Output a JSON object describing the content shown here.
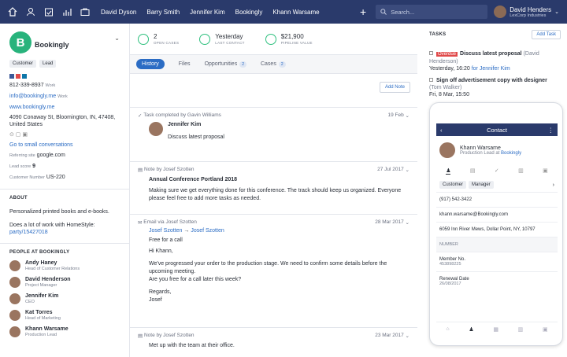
{
  "nav": {
    "links": [
      "David Dyson",
      "Barry Smith",
      "Jennifer Kim",
      "Bookingly",
      "Khann Warsame"
    ],
    "search_placeholder": "Search...",
    "user_name": "David Henders",
    "user_company": "LexCorp Industries"
  },
  "company": {
    "initial": "B",
    "name": "Bookingly",
    "tags": [
      "Customer",
      "Lead"
    ],
    "phone": "812-339-8937",
    "phone_type": "Work",
    "email": "info@bookingly.me",
    "email_type": "Work",
    "website": "www.bookingly.me",
    "address": "4090 Conaway St, Bloomington, IN, 47408, United States",
    "small_link": "Go to small conversations",
    "referring_label": "Referring site",
    "referring": "google.com",
    "lead_label": "Lead score",
    "lead": "9",
    "custnum_label": "Customer Number",
    "custnum": "US-220"
  },
  "about": {
    "title": "ABOUT",
    "text": "Personalized printed books and e-books.",
    "deal": "Does a lot of work with HomeStyle:",
    "deal_link": "party/15427018"
  },
  "people": {
    "title": "PEOPLE AT BOOKINGLY",
    "list": [
      {
        "name": "Andy Haney",
        "role": "Head of Customer Relations"
      },
      {
        "name": "David Henderson",
        "role": "Project Manager"
      },
      {
        "name": "Jennifer Kim",
        "role": "CEO"
      },
      {
        "name": "Kat Torres",
        "role": "Head of Marketing"
      },
      {
        "name": "Khann Warsame",
        "role": "Production Lead"
      }
    ]
  },
  "stats": [
    {
      "value": "2",
      "label": "OPEN CASES"
    },
    {
      "value": "Yesterday",
      "label": "LAST CONTACT"
    },
    {
      "value": "$21,900",
      "label": "PIPELINE VALUE"
    }
  ],
  "tabs": [
    {
      "label": "History"
    },
    {
      "label": "Files"
    },
    {
      "label": "Opportunities",
      "count": "2"
    },
    {
      "label": "Cases",
      "count": "2"
    }
  ],
  "add_note": "Add Note",
  "feed": [
    {
      "head": "Task completed by Gavin Williams",
      "date": "19 Feb",
      "author": "Jennifer Kim",
      "body": "Discuss latest proposal"
    },
    {
      "head": "Note by Josef Szotten",
      "date": "27 Jul 2017",
      "title": "Annual Conference Portland 2018",
      "body": "Making sure we get everything done for this conference. The track should keep us organized. Everyone please feel free to add more tasks as needed."
    },
    {
      "head": "Email via Josef Szotten",
      "date": "28 Mar 2017",
      "from": "Josef Szotten",
      "to": "Josef Szotten",
      "subject": "Free for a call",
      "greet": "Hi Khann,",
      "body": "We've progressed your order to the production stage. We need to confirm some details before the upcoming meeting.",
      "body2": "Are you free for a call later this week?",
      "sign1": "Regards,",
      "sign2": "Josef"
    },
    {
      "head": "Note by Josef Szotten",
      "date": "23 Mar 2017",
      "body": "Met up with the team at their office."
    }
  ],
  "tasks": {
    "title": "TASKS",
    "add": "Add Task",
    "list": [
      {
        "overdue": "Overdue",
        "title": "Discuss latest proposal",
        "who": "(David Henderson)",
        "when": "Yesterday, 16:20",
        "for": "for Jennifer Kim"
      },
      {
        "title": "Sign off advertisement copy with designer",
        "who": "(Tom Walker)",
        "when": "Fri, 8 Mar, 15:50"
      }
    ]
  },
  "phone": {
    "title": "Contact",
    "name": "Khann Warsame",
    "role": "Production Lead at",
    "company": "Bookingly",
    "tags": [
      "Customer",
      "Manager"
    ],
    "tel": "(917) 542-3422",
    "email": "khann.warsame@Bookingly.com",
    "address": "6059 Inn River Mews, Dollar Point, NY, 10797",
    "section": "NUMBER",
    "member_label": "Member No.",
    "member": "453898225",
    "renewal_label": "Renewal Date",
    "renewal": "26/08/2017"
  }
}
